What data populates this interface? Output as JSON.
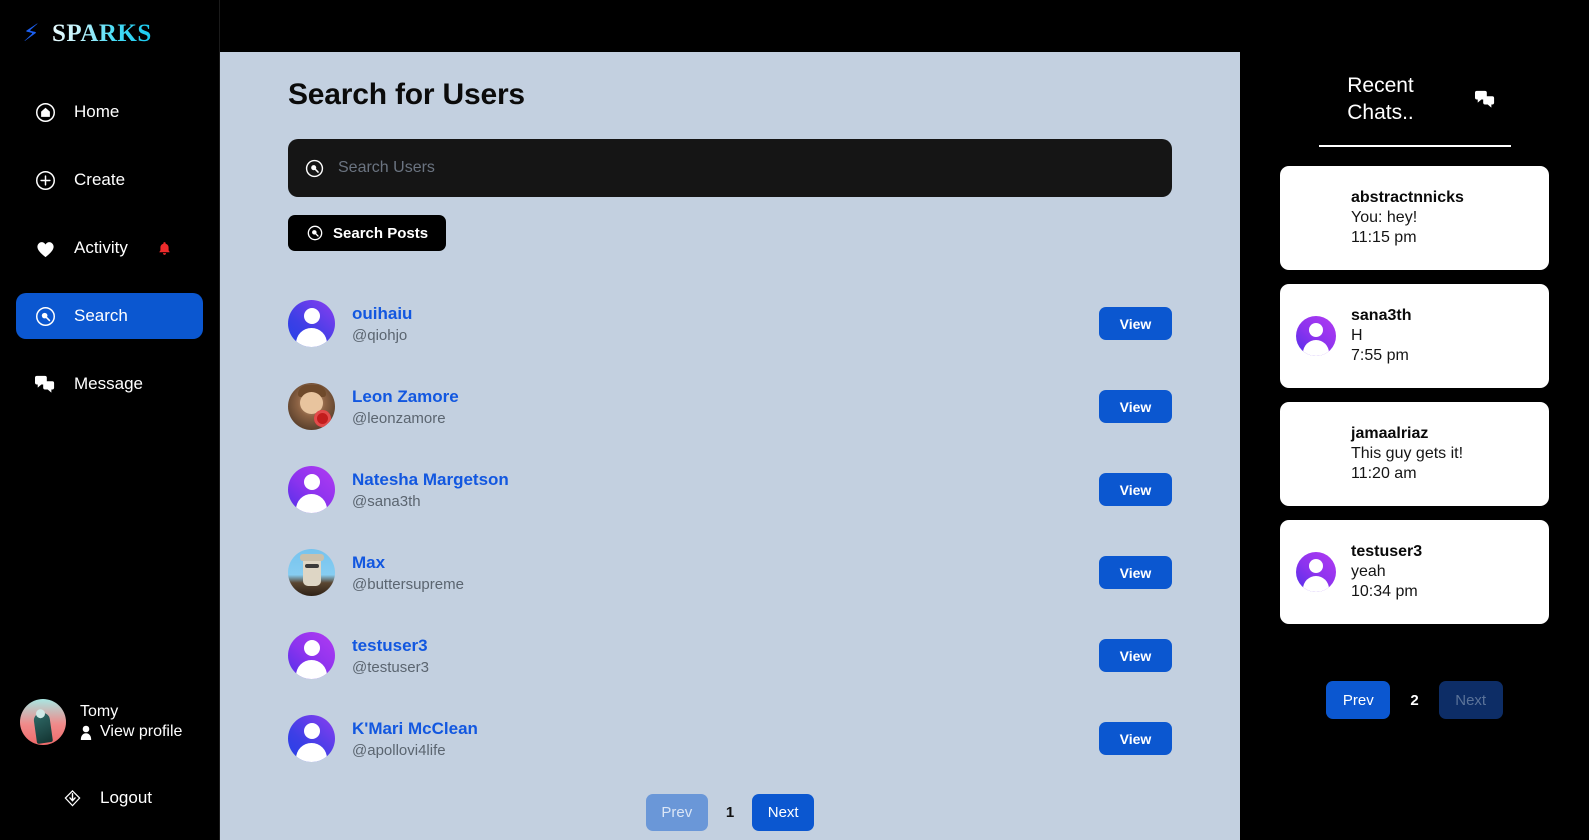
{
  "brand": {
    "name": "SPARKS",
    "bolt_icon": "lightning-bolt-icon",
    "accent": "#17c9f0"
  },
  "sidebar": {
    "items": [
      {
        "label": "Home",
        "icon": "home-circle-icon",
        "active": false,
        "badge": null
      },
      {
        "label": "Create",
        "icon": "plus-circle-icon",
        "active": false,
        "badge": null
      },
      {
        "label": "Activity",
        "icon": "heart-icon",
        "active": false,
        "badge": "bell-icon"
      },
      {
        "label": "Search",
        "icon": "search-circle-icon",
        "active": true,
        "badge": null
      },
      {
        "label": "Message",
        "icon": "message-icon",
        "active": false,
        "badge": null
      }
    ],
    "profile": {
      "name": "Tomy",
      "view_label": "View profile",
      "icon": "person-icon"
    },
    "logout": {
      "label": "Logout",
      "icon": "logout-icon"
    },
    "active_color": "#0b57d0"
  },
  "main": {
    "title": "Search for Users",
    "search": {
      "placeholder": "Search Users",
      "value": "",
      "icon": "search-circle-icon"
    },
    "search_posts_button": {
      "label": "Search Posts",
      "icon": "search-circle-icon"
    },
    "results": [
      {
        "name": "ouihaiu",
        "handle": "@qiohjo",
        "avatar": "default-avatar",
        "action": "View"
      },
      {
        "name": "Leon Zamore",
        "handle": "@leonzamore",
        "avatar": "photo-avatar",
        "action": "View"
      },
      {
        "name": "Natesha Margetson",
        "handle": "@sana3th",
        "avatar": "default-avatar",
        "action": "View"
      },
      {
        "name": "Max",
        "handle": "@buttersupreme",
        "avatar": "photo-avatar",
        "action": "View"
      },
      {
        "name": "testuser3",
        "handle": "@testuser3",
        "avatar": "default-avatar",
        "action": "View"
      },
      {
        "name": "K'Mari McClean",
        "handle": "@apollovi4life",
        "avatar": "default-avatar",
        "action": "View"
      }
    ],
    "pager": {
      "prev": "Prev",
      "page": "1",
      "next": "Next"
    },
    "link_color": "#1257e0",
    "background": "#c3d0e0"
  },
  "chats": {
    "title": "Recent Chats..",
    "new_message_icon": "message-icon",
    "items": [
      {
        "user": "abstractnnicks",
        "last": "You: hey!",
        "time": "11:15 pm",
        "avatar": "photo-avatar"
      },
      {
        "user": "sana3th",
        "last": "H",
        "time": "7:55 pm",
        "avatar": "default-avatar"
      },
      {
        "user": "jamaalriaz",
        "last": "This guy gets it!",
        "time": "11:20 am",
        "avatar": "photo-avatar"
      },
      {
        "user": "testuser3",
        "last": "yeah",
        "time": "10:34 pm",
        "avatar": "default-avatar"
      }
    ],
    "pager": {
      "prev": "Prev",
      "page": "2",
      "next": "Next"
    }
  }
}
